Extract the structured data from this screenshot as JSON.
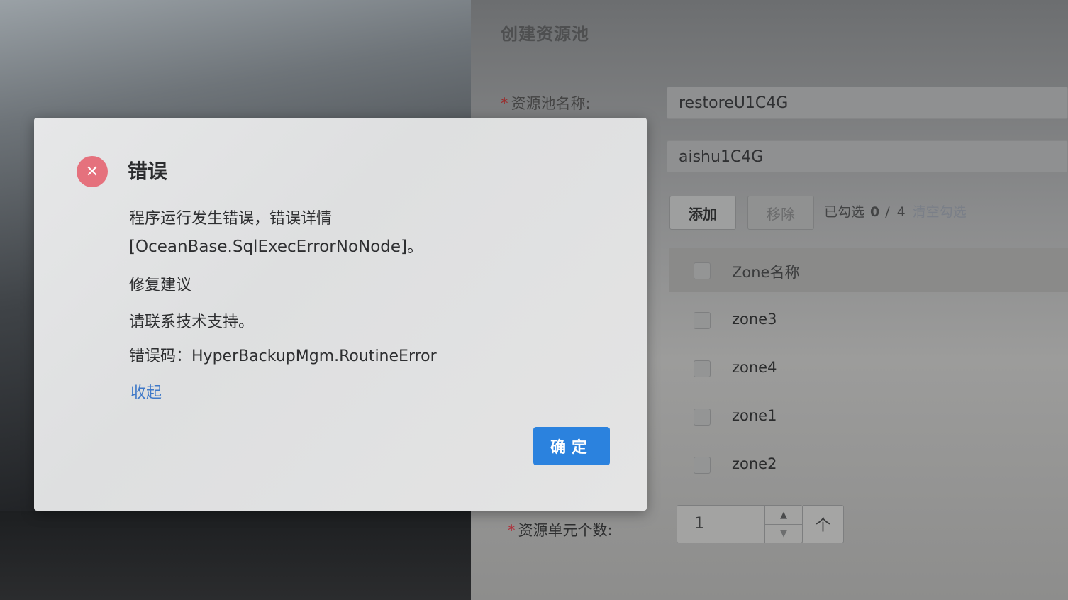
{
  "page": {
    "title": "创建资源池",
    "pool_name_label": "资源池名称:",
    "pool_name_value": "restoreU1C4G",
    "unit_value": "aishu1C4G",
    "add_label": "添加",
    "remove_label": "移除",
    "selected_prefix": "已勾选",
    "selected_count": "0",
    "separator": "/",
    "total_count": "4",
    "clear_label": "清空勾选",
    "zone_header": "Zone名称",
    "zones": [
      "zone3",
      "zone4",
      "zone1",
      "zone2"
    ],
    "unit_count_label": "资源单元个数:",
    "unit_count_value": "1",
    "unit_suffix": "个",
    "required_mark": "*"
  },
  "modal": {
    "title": "错误",
    "message_line1": "程序运行发生错误，错误详情",
    "message_line2": "[OceanBase.SqlExecErrorNoNode]。",
    "fix_heading": "修复建议",
    "fix_text": "请联系技术支持。",
    "error_code": "错误码：HyperBackupMgm.RoutineError",
    "collapse_label": "收起",
    "ok_label": "确定"
  },
  "icons": {
    "error": "close-circle-icon",
    "up": "caret-up-icon",
    "down": "caret-down-icon"
  },
  "colors": {
    "primary": "#2b82de",
    "error": "#e5717d",
    "link": "#3f79c8"
  }
}
